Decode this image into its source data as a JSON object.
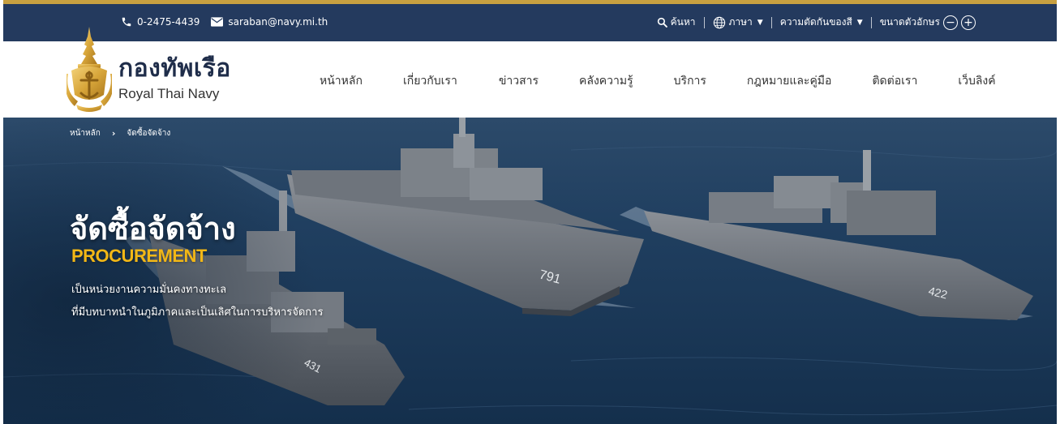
{
  "topbar": {
    "phone": "0-2475-4439",
    "email": "saraban@navy.mi.th",
    "search_label": "ค้นหา",
    "language_label": "ภาษา",
    "contrast_label": "ความตัดกันของสี",
    "font_size_label": "ขนาดตัวอักษร",
    "font_decrease": "−",
    "font_increase": "+"
  },
  "brand": {
    "name_th": "กองทัพเรือ",
    "name_en": "Royal Thai Navy"
  },
  "nav": {
    "items": [
      {
        "label": "หน้าหลัก"
      },
      {
        "label": "เกี่ยวกับเรา"
      },
      {
        "label": "ข่าวสาร"
      },
      {
        "label": "คลังความรู้"
      },
      {
        "label": "บริการ"
      },
      {
        "label": "กฎหมายและคู่มือ"
      },
      {
        "label": "ติดต่อเรา"
      },
      {
        "label": "เว็บลิงค์"
      }
    ]
  },
  "breadcrumb": {
    "home": "หน้าหลัก",
    "current": "จัดซื้อจัดจ้าง"
  },
  "hero": {
    "title": "จัดซื้อจัดจ้าง",
    "subtitle": "PROCUREMENT",
    "desc_line1": "เป็นหน่วยงานความมั่นคงทางทะเล",
    "desc_line2": "ที่มีบทบาทนำในภูมิภาคและเป็นเลิศในการบริหารจัดการ",
    "ship_numbers": [
      "791",
      "422",
      "431"
    ]
  },
  "colors": {
    "topbar_bg": "#243a5e",
    "accent_gold": "#c8a040",
    "subtitle_yellow": "#f2b716"
  }
}
